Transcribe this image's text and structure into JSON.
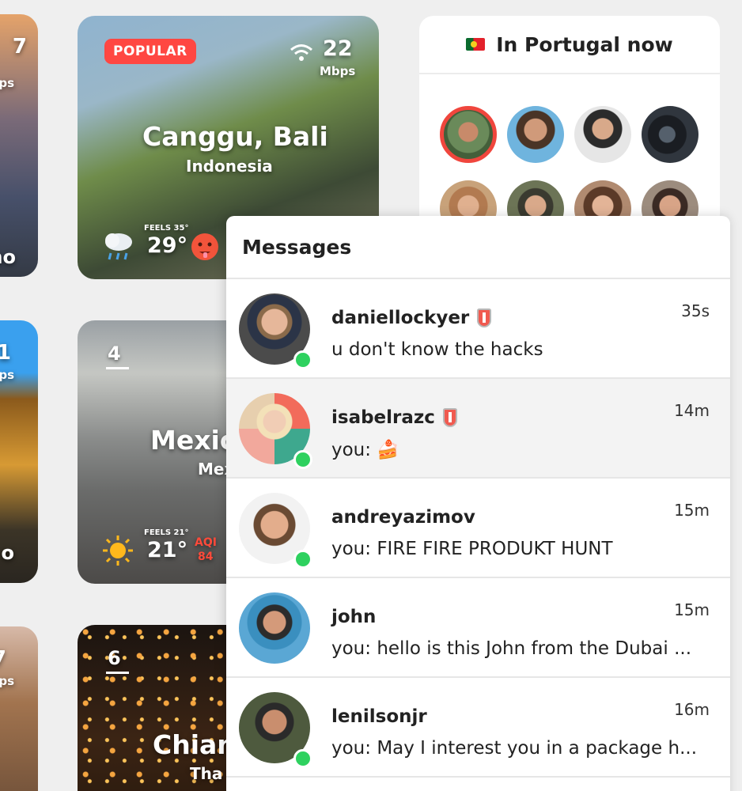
{
  "left_column": {
    "card1": {
      "speed": "7",
      "unit": "ps",
      "city_suffix": "no"
    },
    "card2": {
      "speed": "1",
      "unit": "ps",
      "city_suffix": "o"
    },
    "card3": {
      "speed": "7",
      "unit": "ps"
    }
  },
  "bali_card": {
    "badge": "POPULAR",
    "speed": "22",
    "speed_unit": "Mbps",
    "city": "Canggu, Bali",
    "country": "Indonesia",
    "feels": "FEELS 35°",
    "temp": "29°",
    "weather_icon": "rain-cloud-icon",
    "emoji_icon": "hot-face-icon"
  },
  "mexico_card": {
    "rank": "4",
    "city": "Mexic",
    "country": "Mex",
    "feels": "FEELS 21°",
    "temp": "21°",
    "aqi_label": "AQI",
    "aqi_value": "84",
    "weather_icon": "sun-icon"
  },
  "chiang_card": {
    "rank": "6",
    "city": "Chian",
    "country": "Tha"
  },
  "portugal_panel": {
    "title": "In Portugal now",
    "flag_icon": "portugal-flag-icon"
  },
  "messages": {
    "title": "Messages",
    "items": [
      {
        "name": "daniellockyer",
        "verified": true,
        "time": "35s",
        "text": "u don't know the hacks",
        "online": true
      },
      {
        "name": "isabelrazc",
        "verified": true,
        "time": "14m",
        "text": "you: 🍰",
        "online": true
      },
      {
        "name": "andreyazimov",
        "verified": false,
        "time": "15m",
        "text": "you: FIRE FIRE PRODUKT HUNT",
        "online": true
      },
      {
        "name": "john",
        "verified": false,
        "time": "15m",
        "text": "you: hello is this John from the Dubai ...",
        "online": false
      },
      {
        "name": "lenilsonjr",
        "verified": false,
        "time": "16m",
        "text": "you: May I interest you in a package h...",
        "online": true
      }
    ]
  },
  "colors": {
    "accent_red": "#ff4742",
    "online_green": "#2ed15f"
  }
}
